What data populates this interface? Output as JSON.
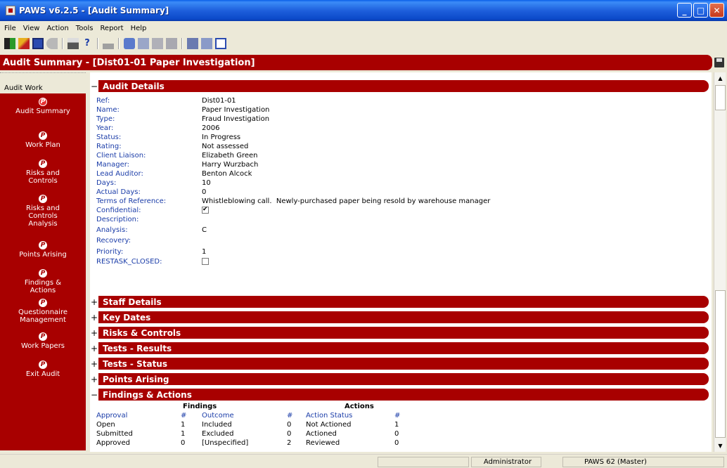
{
  "window": {
    "title": "PAWS v6.2.5 - [Audit Summary]"
  },
  "menu": [
    "File",
    "View",
    "Action",
    "Tools",
    "Report",
    "Help"
  ],
  "header": {
    "title": "Audit Summary - [Dist01-01 Paper Investigation]"
  },
  "sidebar": {
    "heading": "Audit Work",
    "items": [
      {
        "label": "Audit Summary",
        "active": true
      },
      {
        "label": "Work Plan"
      },
      {
        "label": "Risks and Controls"
      },
      {
        "label": "Risks and Controls Analysis"
      },
      {
        "label": "Points Arising"
      },
      {
        "label": "Findings & Actions"
      },
      {
        "label": "Questionnaire Management"
      },
      {
        "label": "Work Papers"
      },
      {
        "label": "Exit Audit"
      }
    ]
  },
  "audit_details": {
    "section_title": "Audit Details",
    "sign": "−",
    "fields": [
      {
        "label": "Ref:",
        "value": "Dist01-01"
      },
      {
        "label": "Name:",
        "value": "Paper Investigation"
      },
      {
        "label": "Type:",
        "value": "Fraud Investigation"
      },
      {
        "label": "Year:",
        "value": "2006"
      },
      {
        "label": "Status:",
        "value": "In Progress"
      },
      {
        "label": "Rating:",
        "value": "Not assessed"
      },
      {
        "label": "Client Liaison:",
        "value": "Elizabeth Green"
      },
      {
        "label": "Manager:",
        "value": "Harry Wurzbach"
      },
      {
        "label": "Lead Auditor:",
        "value": "Benton Alcock"
      },
      {
        "label": "Days:",
        "value": "10"
      },
      {
        "label": "Actual Days:",
        "value": "0"
      },
      {
        "label": "Terms of Reference:",
        "value": "Whistleblowing call.  Newly-purchased paper being resold by warehouse manager"
      },
      {
        "label": "Confidential:",
        "checkbox": true,
        "checked": true
      },
      {
        "label": "Description:",
        "value": ""
      },
      {
        "label": "Analysis:",
        "value": "C"
      },
      {
        "label": "Recovery:",
        "value": ""
      },
      {
        "label": "Priority:",
        "value": "1"
      },
      {
        "label": "RESTASK_CLOSED:",
        "checkbox": true,
        "checked": false
      }
    ]
  },
  "collapsed_sections": [
    {
      "title": "Staff Details",
      "sign": "+"
    },
    {
      "title": "Key Dates",
      "sign": "+"
    },
    {
      "title": "Risks & Controls",
      "sign": "+"
    },
    {
      "title": "Tests - Results",
      "sign": "+"
    },
    {
      "title": "Tests - Status",
      "sign": "+"
    },
    {
      "title": "Points Arising",
      "sign": "+"
    }
  ],
  "findings_actions": {
    "section_title": "Findings & Actions",
    "sign": "−",
    "findings_heading": "Findings",
    "actions_heading": "Actions",
    "col_approval": "Approval",
    "col_hash": "#",
    "col_outcome": "Outcome",
    "col_action_status": "Action Status",
    "rows": [
      {
        "approval": "Open",
        "a_count": "1",
        "outcome": "Included",
        "o_count": "0",
        "action_status": "Not Actioned",
        "s_count": "1"
      },
      {
        "approval": "Submitted",
        "a_count": "1",
        "outcome": "Excluded",
        "o_count": "0",
        "action_status": "Actioned",
        "s_count": "0"
      },
      {
        "approval": "Approved",
        "a_count": "0",
        "outcome": "[Unspecified]",
        "o_count": "2",
        "action_status": "Reviewed",
        "s_count": "0"
      }
    ]
  },
  "status_bar": {
    "user": "Administrator",
    "database": "PAWS 62 (Master)"
  }
}
